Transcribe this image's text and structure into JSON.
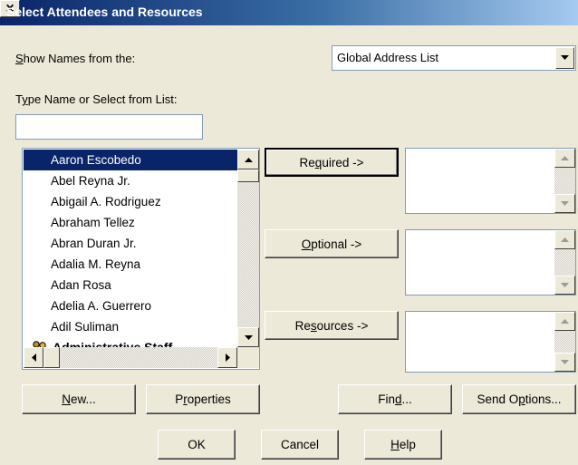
{
  "dialog": {
    "title": "Select Attendees and Resources",
    "close_glyph": "×"
  },
  "show_names": {
    "label_prefix": "",
    "label_key": "S",
    "label_rest": "how Names from the:",
    "selected": "Global Address List"
  },
  "search": {
    "label_pre": "T",
    "label_key": "y",
    "label_rest": "pe Name or Select from List:",
    "value": ""
  },
  "list": {
    "selected_index": 0,
    "items": [
      {
        "label": "Aaron Escobedo",
        "bold": false
      },
      {
        "label": "Abel Reyna Jr.",
        "bold": false
      },
      {
        "label": "Abigail A. Rodriguez",
        "bold": false
      },
      {
        "label": "Abraham Tellez",
        "bold": false
      },
      {
        "label": "Abran Duran Jr.",
        "bold": false
      },
      {
        "label": "Adalia M. Reyna",
        "bold": false
      },
      {
        "label": "Adan Rosa",
        "bold": false
      },
      {
        "label": "Adelia A. Guerrero",
        "bold": false
      },
      {
        "label": "Adil Suliman",
        "bold": false
      },
      {
        "label": "Administrative Staff",
        "bold": true
      }
    ]
  },
  "buttons": {
    "required": {
      "pre": "Re",
      "key": "q",
      "post": "uired ->"
    },
    "optional": {
      "pre": "",
      "key": "O",
      "post": "ptional ->"
    },
    "resources": {
      "pre": "Re",
      "key": "s",
      "post": "ources ->"
    },
    "new": {
      "pre": "",
      "key": "N",
      "post": "ew..."
    },
    "properties": {
      "pre": "P",
      "key": "r",
      "post": "operties"
    },
    "find": {
      "pre": "Fin",
      "key": "d",
      "post": "..."
    },
    "send_options": {
      "pre": "Send O",
      "key": "p",
      "post": "tions..."
    },
    "ok": {
      "pre": "OK",
      "key": "",
      "post": ""
    },
    "cancel": {
      "pre": "Cancel",
      "key": "",
      "post": ""
    },
    "help": {
      "pre": "",
      "key": "H",
      "post": "elp"
    }
  }
}
